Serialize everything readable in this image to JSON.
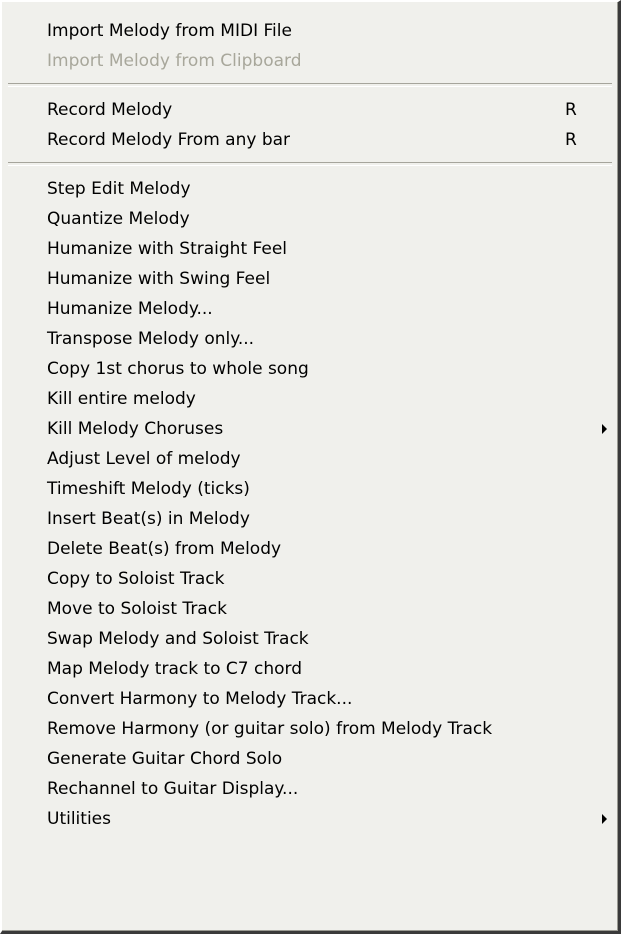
{
  "menu": {
    "group1": [
      {
        "label": "Import Melody from MIDI File"
      },
      {
        "label": "Import Melody from Clipboard",
        "disabled": true
      }
    ],
    "group2": [
      {
        "label": "Record Melody",
        "shortcut": "R"
      },
      {
        "label": "Record Melody From any bar",
        "shortcut": "R"
      }
    ],
    "group3": [
      {
        "label": "Step Edit Melody"
      },
      {
        "label": "Quantize Melody"
      },
      {
        "label": "Humanize with Straight Feel"
      },
      {
        "label": "Humanize with Swing Feel"
      },
      {
        "label": "Humanize Melody..."
      },
      {
        "label": "Transpose Melody only..."
      },
      {
        "label": "Copy 1st chorus to whole song"
      },
      {
        "label": "Kill entire melody"
      },
      {
        "label": "Kill Melody Choruses",
        "submenu": true
      },
      {
        "label": "Adjust Level of melody"
      },
      {
        "label": "Timeshift Melody (ticks)"
      },
      {
        "label": "Insert Beat(s) in Melody"
      },
      {
        "label": "Delete Beat(s) from Melody"
      },
      {
        "label": "Copy to Soloist Track"
      },
      {
        "label": "Move to Soloist Track"
      },
      {
        "label": "Swap Melody and Soloist Track"
      },
      {
        "label": "Map Melody track to C7 chord"
      },
      {
        "label": "Convert Harmony to Melody Track..."
      },
      {
        "label": "Remove Harmony (or guitar solo) from Melody Track"
      },
      {
        "label": "Generate Guitar Chord Solo"
      },
      {
        "label": "Rechannel to Guitar Display..."
      },
      {
        "label": "Utilities",
        "submenu": true
      }
    ]
  },
  "icons": {
    "submenu_arrow": "submenu-arrow-icon"
  }
}
